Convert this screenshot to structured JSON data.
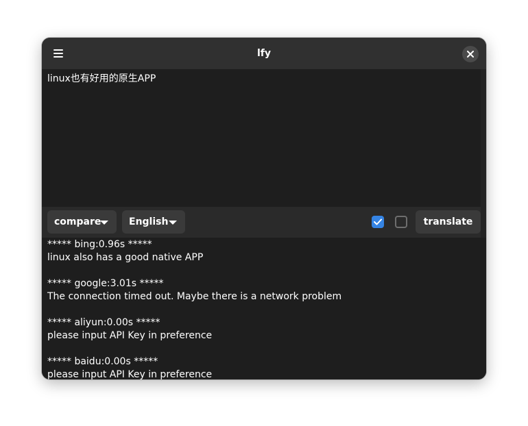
{
  "window": {
    "title": "lfy"
  },
  "source": {
    "text": "linux也有好用的原生APP"
  },
  "toolbar": {
    "mode_dropdown": "compare",
    "language_dropdown": "English",
    "checkbox1_checked": true,
    "checkbox2_checked": false,
    "translate_label": "translate"
  },
  "results": [
    {
      "header": "***** bing:0.96s *****",
      "text": "linux also has a good native APP"
    },
    {
      "header": "***** google:3.01s *****",
      "text": "The connection timed out. Maybe there is a network problem"
    },
    {
      "header": "***** aliyun:0.00s *****",
      "text": "please input API Key in preference"
    },
    {
      "header": "***** baidu:0.00s *****",
      "text": "please input API Key in preference"
    }
  ],
  "icons": {
    "menu": "hamburger-menu-icon",
    "close": "close-icon",
    "dropdown": "triangle-down-icon",
    "check": "checkmark-icon"
  },
  "colors": {
    "accent": "#3584e4",
    "window_bg": "#242424",
    "header_bg": "#303030",
    "text": "#ffffff"
  }
}
